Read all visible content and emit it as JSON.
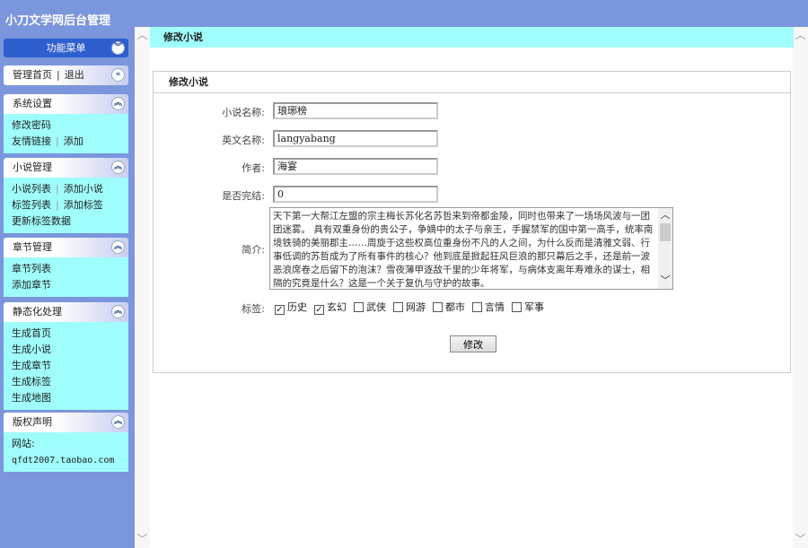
{
  "app": {
    "title": "小刀文学网后台管理"
  },
  "sidebar": {
    "menu_title": "功能菜单",
    "quick": {
      "home": "管理首页",
      "sep": "|",
      "logout": "退出"
    },
    "groups": [
      {
        "title": "系统设置",
        "rows": [
          [
            "修改密码"
          ],
          [
            "友情链接",
            "添加"
          ]
        ]
      },
      {
        "title": "小说管理",
        "rows": [
          [
            "小说列表",
            "添加小说"
          ],
          [
            "标签列表",
            "添加标签"
          ],
          [
            "更新标签数据"
          ]
        ]
      },
      {
        "title": "章节管理",
        "rows": [
          [
            "章节列表"
          ],
          [
            "添加章节"
          ]
        ]
      },
      {
        "title": "静态化处理",
        "rows": [
          [
            "生成首页"
          ],
          [
            "生成小说"
          ],
          [
            "生成章节"
          ],
          [
            "生成标签"
          ],
          [
            "生成地图"
          ]
        ]
      },
      {
        "title": "版权声明",
        "rows": [
          [
            "网站:"
          ],
          [
            "qfdt2007.taobao.com"
          ]
        ]
      }
    ]
  },
  "main": {
    "breadcrumb": "修改小说",
    "panel_title": "修改小说",
    "form": {
      "name_label": "小说名称:",
      "name_value": "琅琊榜",
      "en_label": "英文名称:",
      "en_value": "langyabang",
      "author_label": "作者:",
      "author_value": "海宴",
      "finished_label": "是否完结:",
      "finished_value": "0",
      "intro_label": "简介:",
      "intro_value": "天下第一大帮江左盟的宗主梅长苏化名苏哲来到帝都金陵，同时也带来了一场场风波与一团团迷雾。 具有双重身份的贵公子，争嫡中的太子与亲王，手握禁军的国中第一高手，统率南境铁骑的美丽郡主……周旋于这些权高位重身份不凡的人之间，为什么反而是清雅文弱、行事低调的苏哲成为了所有事件的核心？他到底是掀起狂风巨浪的那只幕后之手，还是前一波恶浪席卷之后留下的泡沫？雪夜薄甲逐敌千里的少年将军，与病体支离年寿难永的谋士，相隔的究竟是什么？这是一个关于复仇与守护的故事。",
      "tags_label": "标签:",
      "tags": [
        {
          "label": "历史",
          "checked": true
        },
        {
          "label": "玄幻",
          "checked": true
        },
        {
          "label": "武侠",
          "checked": false
        },
        {
          "label": "网游",
          "checked": false
        },
        {
          "label": "都市",
          "checked": false
        },
        {
          "label": "言情",
          "checked": false
        },
        {
          "label": "军事",
          "checked": false
        }
      ],
      "submit_label": "修改"
    }
  }
}
